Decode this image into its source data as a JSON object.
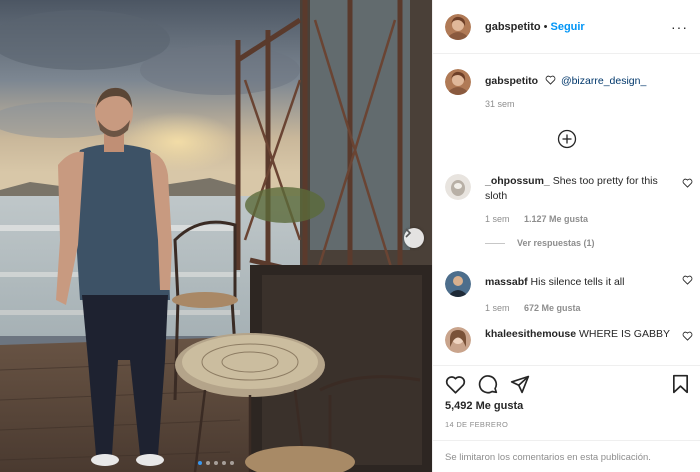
{
  "post": {
    "author": "gabspetito",
    "separator": "•",
    "follow_label": "Seguir",
    "more_label": "···",
    "photo_description": "man-standing-on-pier-photo"
  },
  "caption": {
    "username": "gabspetito",
    "mention": "@bizarre_design_",
    "age": "31 sem"
  },
  "comments": [
    {
      "username": "_ohpossum_",
      "text": "Shes too pretty for this sloth",
      "age": "1 sem",
      "likes": "1.127 Me gusta",
      "replies": "Ver respuestas (1)"
    },
    {
      "username": "massabf",
      "text": "His silence tells it all",
      "age": "1 sem",
      "likes": "672 Me gusta"
    },
    {
      "username": "khaleesithemouse",
      "text": "WHERE IS GABBY"
    }
  ],
  "stats": {
    "likes": "5,492 Me gusta",
    "date": "14 DE FEBRERO"
  },
  "footer": {
    "limited_notice": "Se limitaron los comentarios en esta publicación."
  },
  "colors": {
    "accent": "#0095f6",
    "text": "#262626",
    "muted": "#8e8e8e",
    "divider": "#efefef"
  }
}
